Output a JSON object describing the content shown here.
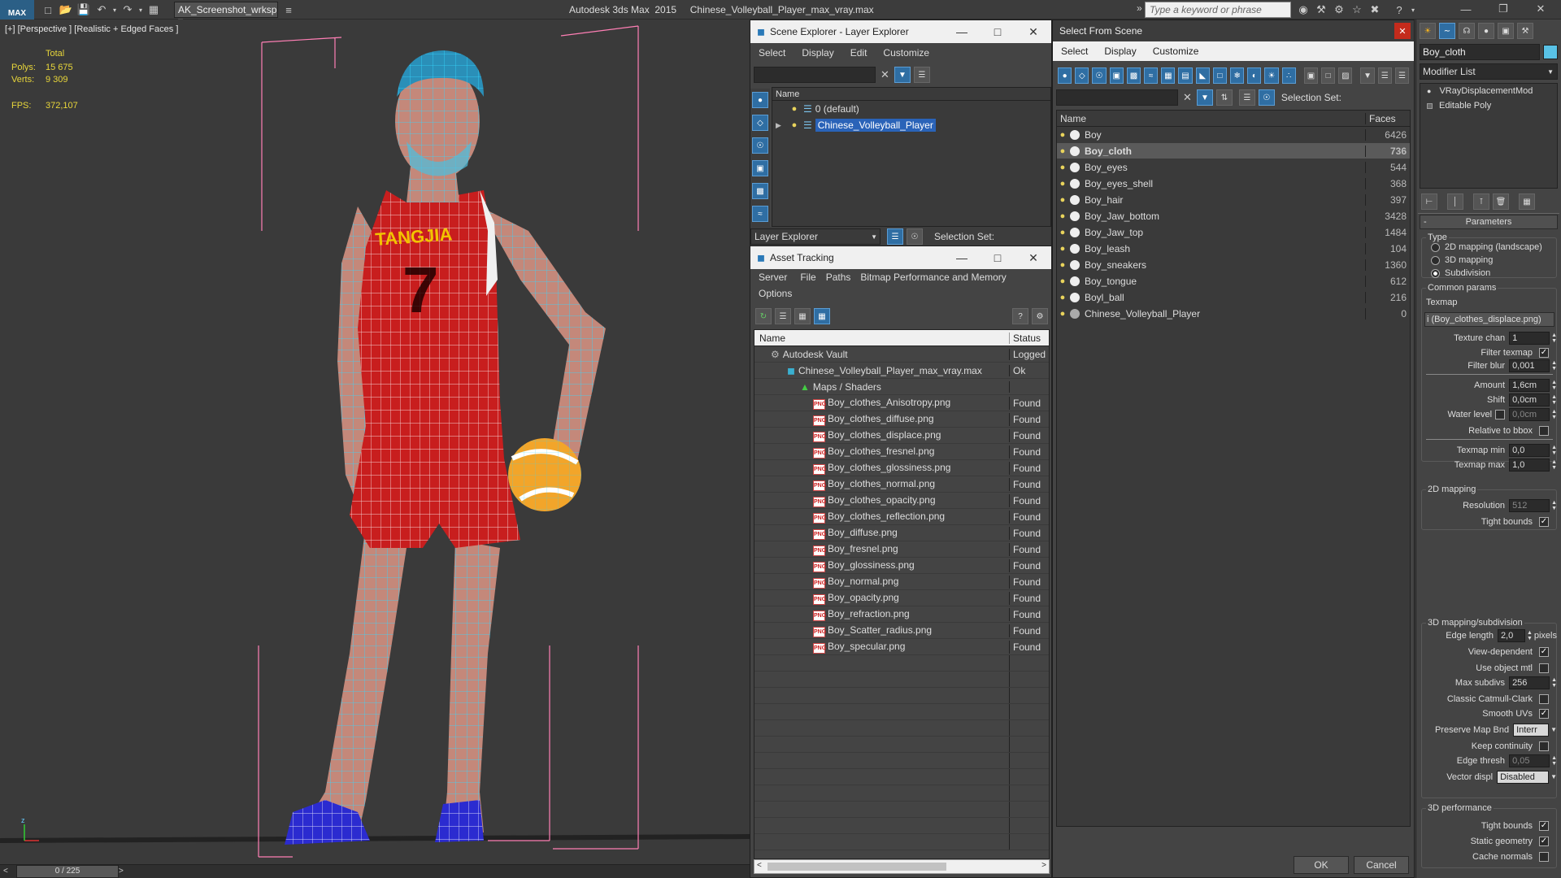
{
  "app": {
    "logo": "MAX",
    "workspace": "AK_Screenshot_wrksp",
    "title": "Autodesk 3ds Max  2015     Chinese_Volleyball_Player_max_vray.max",
    "search_placeholder": "Type a keyword or phrase"
  },
  "viewport": {
    "label": "[+] [Perspective ] [Realistic + Edged Faces ]",
    "stats": {
      "total_label": "Total",
      "polys_label": "Polys:",
      "polys": "15 675",
      "verts_label": "Verts:",
      "verts": "9 309",
      "fps_label": "FPS:",
      "fps": "372,107"
    },
    "jersey_text": "TANGJIA",
    "jersey_number": "7"
  },
  "timeline": {
    "frame": "0 / 225"
  },
  "scene_explorer": {
    "title": "Scene Explorer - Layer Explorer",
    "menu": [
      "Select",
      "Display",
      "Edit",
      "Customize"
    ],
    "column": "Name",
    "layers": [
      "0 (default)",
      "Chinese_Volleyball_Player"
    ],
    "bottom_label": "Layer Explorer",
    "selection_set": "Selection Set:"
  },
  "asset_tracking": {
    "title": "Asset Tracking",
    "menu": [
      "Server",
      "File",
      "Paths",
      "Bitmap Performance and Memory",
      "Options"
    ],
    "col_name": "Name",
    "col_status": "Status",
    "vault": {
      "name": "Autodesk Vault",
      "status": "Logged"
    },
    "file": {
      "name": "Chinese_Volleyball_Player_max_vray.max",
      "status": "Ok"
    },
    "maps_folder": "Maps / Shaders",
    "maps": [
      {
        "name": "Boy_clothes_Anisotropy.png",
        "status": "Found"
      },
      {
        "name": "Boy_clothes_diffuse.png",
        "status": "Found"
      },
      {
        "name": "Boy_clothes_displace.png",
        "status": "Found"
      },
      {
        "name": "Boy_clothes_fresnel.png",
        "status": "Found"
      },
      {
        "name": "Boy_clothes_glossiness.png",
        "status": "Found"
      },
      {
        "name": "Boy_clothes_normal.png",
        "status": "Found"
      },
      {
        "name": "Boy_clothes_opacity.png",
        "status": "Found"
      },
      {
        "name": "Boy_clothes_reflection.png",
        "status": "Found"
      },
      {
        "name": "Boy_diffuse.png",
        "status": "Found"
      },
      {
        "name": "Boy_fresnel.png",
        "status": "Found"
      },
      {
        "name": "Boy_glossiness.png",
        "status": "Found"
      },
      {
        "name": "Boy_normal.png",
        "status": "Found"
      },
      {
        "name": "Boy_opacity.png",
        "status": "Found"
      },
      {
        "name": "Boy_refraction.png",
        "status": "Found"
      },
      {
        "name": "Boy_Scatter_radius.png",
        "status": "Found"
      },
      {
        "name": "Boy_specular.png",
        "status": "Found"
      }
    ]
  },
  "select_from_scene": {
    "title": "Select From Scene",
    "menu": [
      "Select",
      "Display",
      "Customize"
    ],
    "selection_set": "Selection Set:",
    "col_name": "Name",
    "col_faces": "Faces",
    "objects": [
      {
        "name": "Boy",
        "faces": "6426"
      },
      {
        "name": "Boy_cloth",
        "faces": "736"
      },
      {
        "name": "Boy_eyes",
        "faces": "544"
      },
      {
        "name": "Boy_eyes_shell",
        "faces": "368"
      },
      {
        "name": "Boy_hair",
        "faces": "397"
      },
      {
        "name": "Boy_Jaw_bottom",
        "faces": "3428"
      },
      {
        "name": "Boy_Jaw_top",
        "faces": "1484"
      },
      {
        "name": "Boy_leash",
        "faces": "104"
      },
      {
        "name": "Boy_sneakers",
        "faces": "1360"
      },
      {
        "name": "Boy_tongue",
        "faces": "612"
      },
      {
        "name": "Boyl_ball",
        "faces": "216"
      },
      {
        "name": "Chinese_Volleyball_Player",
        "faces": "0"
      }
    ],
    "ok": "OK",
    "cancel": "Cancel"
  },
  "command_panel": {
    "object_name": "Boy_cloth",
    "modifier_list": "Modifier List",
    "stack": [
      "VRayDisplacementMod",
      "Editable Poly"
    ],
    "rollout": "Parameters",
    "type_label": "Type",
    "type_options": [
      "2D mapping (landscape)",
      "3D mapping",
      "Subdivision"
    ],
    "common_label": "Common params",
    "texmap_label": "Texmap",
    "texmap_value": "i (Boy_clothes_displace.png)",
    "texture_chan_label": "Texture chan",
    "texture_chan": "1",
    "filter_texmap_label": "Filter texmap",
    "filter_blur_label": "Filter blur",
    "filter_blur": "0,001",
    "amount_label": "Amount",
    "amount": "1,6cm",
    "shift_label": "Shift",
    "shift": "0,0cm",
    "water_label": "Water level",
    "water": "0,0cm",
    "relbbox_label": "Relative to bbox",
    "tmin_label": "Texmap min",
    "tmin": "0,0",
    "tmax_label": "Texmap max",
    "tmax": "1,0",
    "map2d_label": "2D mapping",
    "resolution_label": "Resolution",
    "resolution": "512",
    "tight_label": "Tight bounds",
    "map3d_label": "3D mapping/subdivision",
    "edge_label": "Edge length",
    "edge": "2,0",
    "edge_unit": "pixels",
    "viewdep_label": "View-dependent",
    "useobj_label": "Use object mtl",
    "maxsub_label": "Max subdivs",
    "maxsub": "256",
    "catmull_label": "Classic Catmull-Clark",
    "smoothuv_label": "Smooth UVs",
    "preserve_label": "Preserve Map Bnd",
    "preserve": "Interr",
    "keepc_label": "Keep continuity",
    "edgethr_label": "Edge thresh",
    "edgethr": "0,05",
    "vecdisp_label": "Vector displ",
    "vecdisp": "Disabled",
    "perf_label": "3D performance",
    "tight2_label": "Tight bounds",
    "static_label": "Static geometry",
    "cache_label": "Cache normals"
  }
}
